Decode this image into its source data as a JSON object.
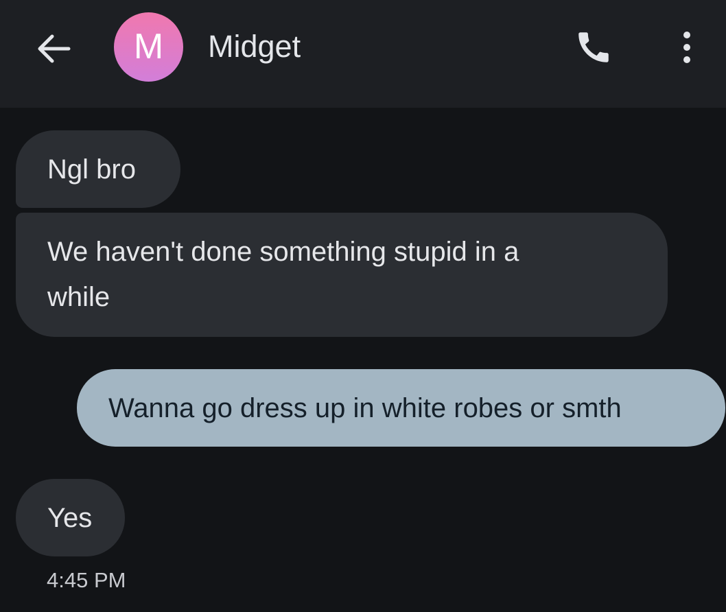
{
  "header": {
    "avatar_letter": "M",
    "contact_name": "Midget",
    "icons": [
      "back-arrow-icon",
      "phone-icon",
      "more-vert-icon"
    ]
  },
  "messages": [
    {
      "direction": "incoming",
      "text": "Ngl bro"
    },
    {
      "direction": "incoming",
      "text": "We haven't done something stupid in a\nwhile"
    },
    {
      "direction": "outgoing",
      "text": "Wanna go dress up in white robes or smth"
    },
    {
      "direction": "incoming",
      "text": "Yes"
    }
  ],
  "timestamp": "4:45 PM",
  "colors": {
    "background": "#121417",
    "appbar": "#1d1f23",
    "incoming_bubble": "#2b2e33",
    "outgoing_bubble": "#a3b6c3",
    "avatar_gradient": [
      "#f078ae",
      "#d27ed9"
    ]
  }
}
